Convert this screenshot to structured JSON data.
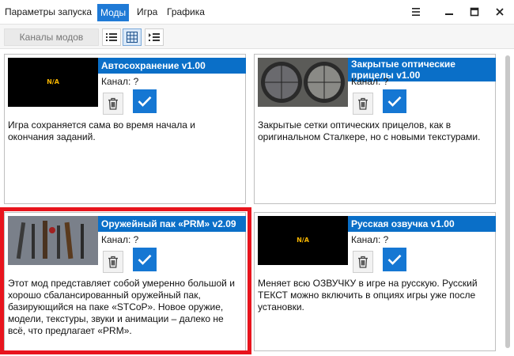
{
  "tabs": [
    {
      "label": "Параметры запуска",
      "active": false
    },
    {
      "label": "Моды",
      "active": true
    },
    {
      "label": "Игра",
      "active": false
    },
    {
      "label": "Графика",
      "active": false
    }
  ],
  "window_icons": [
    "menu-icon",
    "minimize-icon",
    "maximize-icon",
    "close-icon"
  ],
  "toolbar": {
    "channels_label": "Каналы модов",
    "view_modes": [
      "list-view-icon",
      "grid-view-icon",
      "detail-view-icon"
    ],
    "selected_view": "grid-view-icon"
  },
  "mods": [
    {
      "title": "Автосохранение v1.00",
      "channel": "Канал: ?",
      "thumbnail": "N/A",
      "description": "Игра сохраняется сама во время начала и окончания заданий."
    },
    {
      "title": "Закрытые оптические прицелы v1.00",
      "channel": "Канал: ?",
      "thumbnail": "scope-images",
      "description": "Закрытые сетки оптических прицелов, как в оригинальном Сталкере, но с новыми текстурами."
    },
    {
      "title": "Оружейный пак «PRM» v2.09",
      "channel": "Канал: ?",
      "thumbnail": "weapons-image",
      "description": "Этот мод представляет собой умеренно большой и хорошо сбалансированный оружейный пак, базирующийся на паке «STCoP». Новое оружие, модели, текстуры, звуки и анимации – далеко не всё, что предлагает «PRM»."
    },
    {
      "title": "Русская озвучка v1.00",
      "channel": "Канал: ?",
      "thumbnail": "N/A",
      "description": "Меняет всю ОЗВУЧКУ в игре на русскую. Русский ТЕКСТ можно включить в опциях игры уже после установки."
    }
  ],
  "colors": {
    "accent": "#1577d3",
    "title_bar": "#0a6fc8",
    "highlight": "#e8141d",
    "na_text": "#f5b400"
  }
}
